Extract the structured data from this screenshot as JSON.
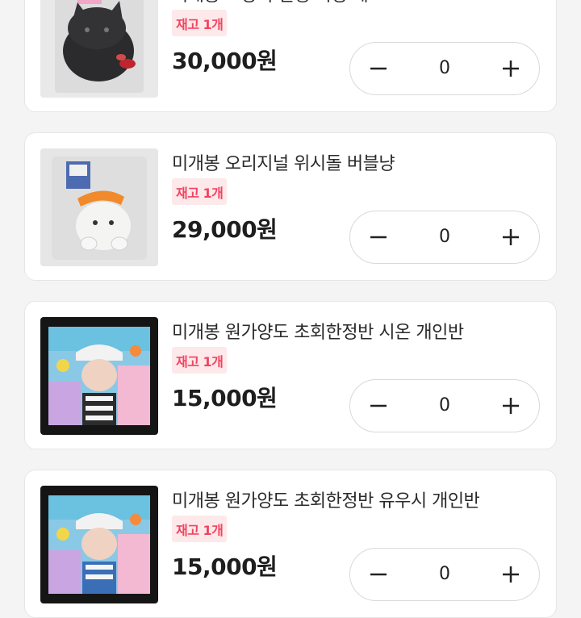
{
  "products": [
    {
      "title": "미개봉 고양이 인형 키링 세트",
      "stock_badge": "재고 1개",
      "price": "30,000원",
      "quantity": "0",
      "minus_icon": "minus-icon",
      "plus_icon": "plus-icon"
    },
    {
      "title": "미개봉 오리지널 위시돌 버블냥",
      "stock_badge": "재고 1개",
      "price": "29,000원",
      "quantity": "0",
      "minus_icon": "minus-icon",
      "plus_icon": "plus-icon"
    },
    {
      "title": "미개봉 원가양도 초회한정반 시온 개인반",
      "stock_badge": "재고 1개",
      "price": "15,000원",
      "quantity": "0",
      "minus_icon": "minus-icon",
      "plus_icon": "plus-icon"
    },
    {
      "title": "미개봉 원가양도 초회한정반 유우시 개인반",
      "stock_badge": "재고 1개",
      "price": "15,000원",
      "quantity": "0",
      "minus_icon": "minus-icon",
      "plus_icon": "plus-icon"
    }
  ],
  "colors": {
    "badge_text": "#f04460",
    "badge_bg": "#fde8ea",
    "page_bg": "#f4f4f4",
    "card_bg": "#ffffff"
  }
}
